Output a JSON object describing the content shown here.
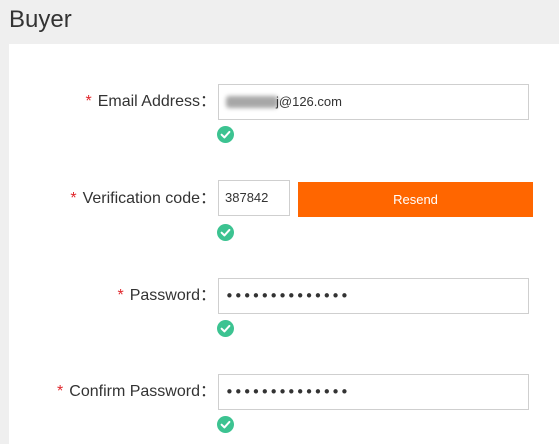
{
  "page": {
    "title": "Buyer"
  },
  "form": {
    "email": {
      "required_mark": "*",
      "label": "Email Address：",
      "value_visible": "j@126.com",
      "value_obscured": true
    },
    "verification": {
      "required_mark": "*",
      "label": "Verification code：",
      "value": "387842",
      "resend_label": "Resend"
    },
    "password": {
      "required_mark": "*",
      "label": "Password：",
      "value": "••••••••••••••"
    },
    "confirm_password": {
      "required_mark": "*",
      "label": "Confirm Password：",
      "value": "••••••••••••••"
    },
    "valid_icon": "check-circle-icon"
  },
  "colors": {
    "accent": "#ff6600",
    "required": "#e0262b",
    "valid": "#3cc391"
  }
}
